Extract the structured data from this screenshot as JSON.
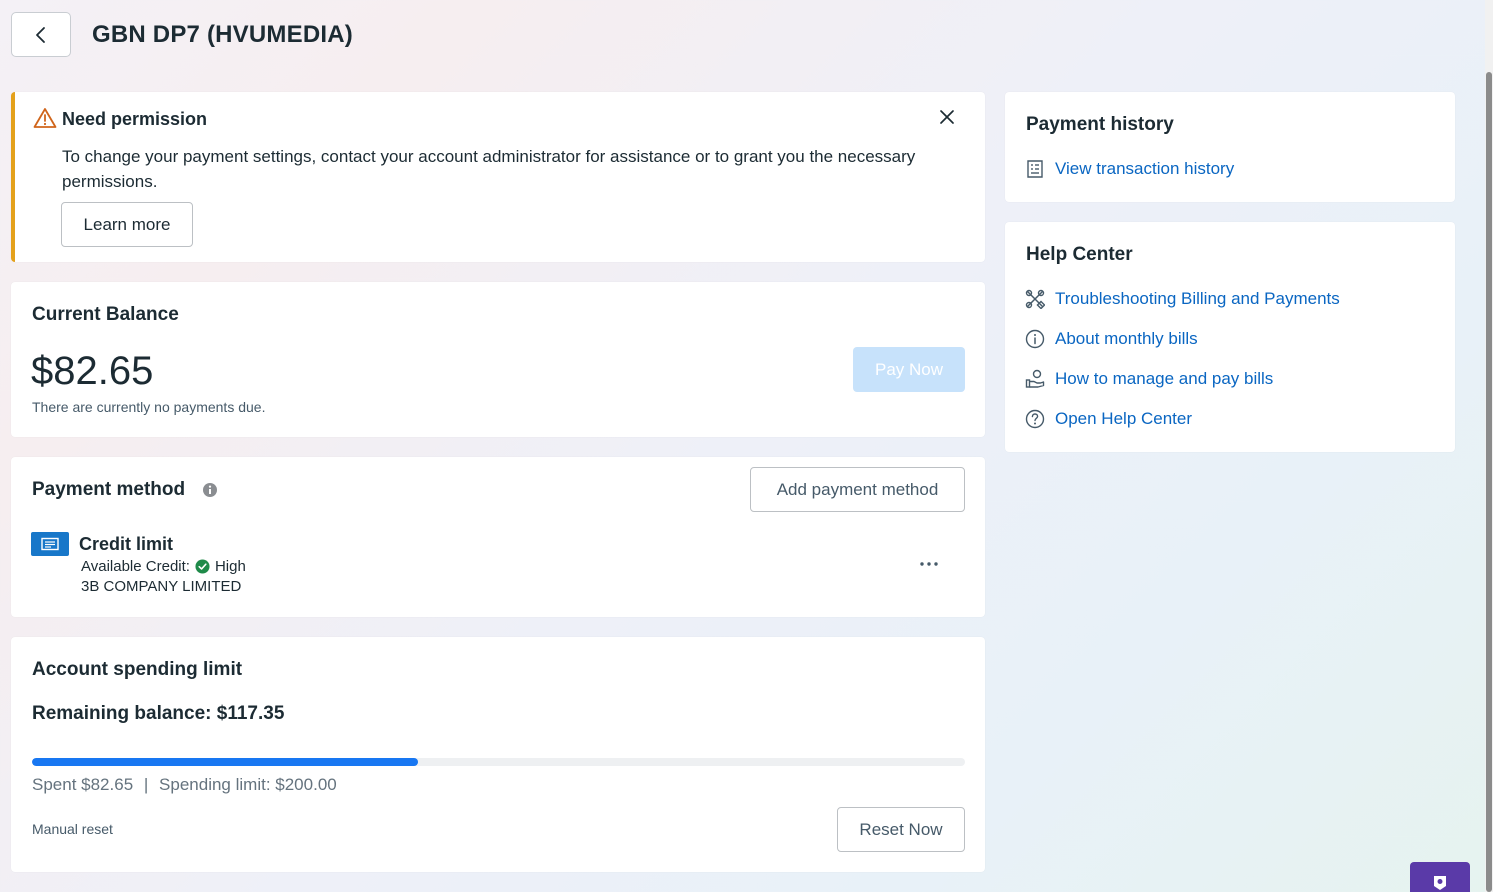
{
  "header": {
    "title": "GBN DP7 (HVUMEDIA)"
  },
  "banner": {
    "title": "Need permission",
    "body": "To change your payment settings, contact your account administrator for assistance or to grant you the necessary permissions.",
    "learn_more_label": "Learn more",
    "accent_color": "#e4a11b"
  },
  "current_balance": {
    "title": "Current Balance",
    "amount": "$82.65",
    "note": "There are currently no payments due.",
    "pay_now_label": "Pay Now"
  },
  "payment_method": {
    "title": "Payment method",
    "add_label": "Add payment method",
    "method": {
      "name": "Credit limit",
      "available_label": "Available Credit:",
      "available_value": "High",
      "company": "3B COMPANY LIMITED"
    }
  },
  "spending_limit": {
    "title": "Account spending limit",
    "remaining": "Remaining balance: $117.35",
    "spent_fraction": 0.41325,
    "spent_text": "Spent $82.65",
    "separator": "|",
    "limit_text": "Spending limit: $200.00",
    "reset_type": "Manual reset",
    "reset_label": "Reset Now"
  },
  "payment_history": {
    "title": "Payment history",
    "link_label": "View transaction history",
    "link_icon": "receipt-icon"
  },
  "help_center": {
    "title": "Help Center",
    "links": [
      {
        "label": "Troubleshooting Billing and Payments",
        "icon": "tools-icon"
      },
      {
        "label": "About monthly bills",
        "icon": "info-icon"
      },
      {
        "label": "How to manage and pay bills",
        "icon": "hand-coins-icon"
      },
      {
        "label": "Open Help Center",
        "icon": "question-icon"
      }
    ]
  },
  "colors": {
    "link": "#0a66c2",
    "primary": "#1877f2",
    "pay_disabled": "#c7e2fb",
    "success": "#1f8a49"
  }
}
